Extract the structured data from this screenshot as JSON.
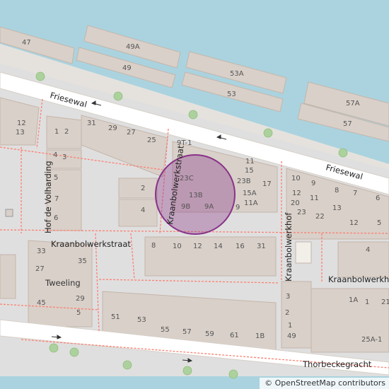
{
  "map": {
    "colors": {
      "water": "#aad3df",
      "land": "#f2efe9",
      "building": "#d9d0c9",
      "building_outline": "#c4b6ab",
      "road": "#ffffff",
      "residential": "#e0dfdf",
      "footway": "#fa8072",
      "tree": "#add19e",
      "circle_fill": "rgba(136,51,136,0.35)",
      "circle_stroke": "#883388"
    },
    "streets": [
      {
        "name": "Friesewal"
      },
      {
        "name": "Friesewal"
      },
      {
        "name": "Hof de Volharding"
      },
      {
        "name": "Kraanbolwerkstraat"
      },
      {
        "name": "Kraanbolwerkstraat"
      },
      {
        "name": "Kraanbolwerkhof"
      },
      {
        "name": "Kraanbolwerkhof"
      },
      {
        "name": "Thorbeckegracht"
      }
    ],
    "house_numbers": [
      "47",
      "49A",
      "49",
      "53A",
      "53",
      "57A",
      "57",
      "12",
      "13",
      "1",
      "2",
      "31",
      "29",
      "27",
      "25",
      "9T-1",
      "4",
      "3",
      "23C",
      "13B",
      "9B",
      "9A",
      "11",
      "15",
      "23B",
      "15A",
      "11A",
      "9",
      "17",
      "10",
      "9",
      "8",
      "7",
      "6",
      "12",
      "11",
      "20",
      "23",
      "22",
      "13",
      "12",
      "5",
      "2",
      "4",
      "5",
      "7",
      "6",
      "8",
      "10",
      "12",
      "14",
      "16",
      "31",
      "33",
      "35",
      "27",
      "45",
      "29",
      "5",
      "4",
      "3",
      "2",
      "1",
      "49",
      "51",
      "53",
      "55",
      "57",
      "59",
      "61",
      "1B",
      "1A",
      "1",
      "21",
      "25A-1"
    ],
    "place_names": [
      "Tweeling"
    ],
    "attribution": "© OpenStreetMap contributors"
  }
}
